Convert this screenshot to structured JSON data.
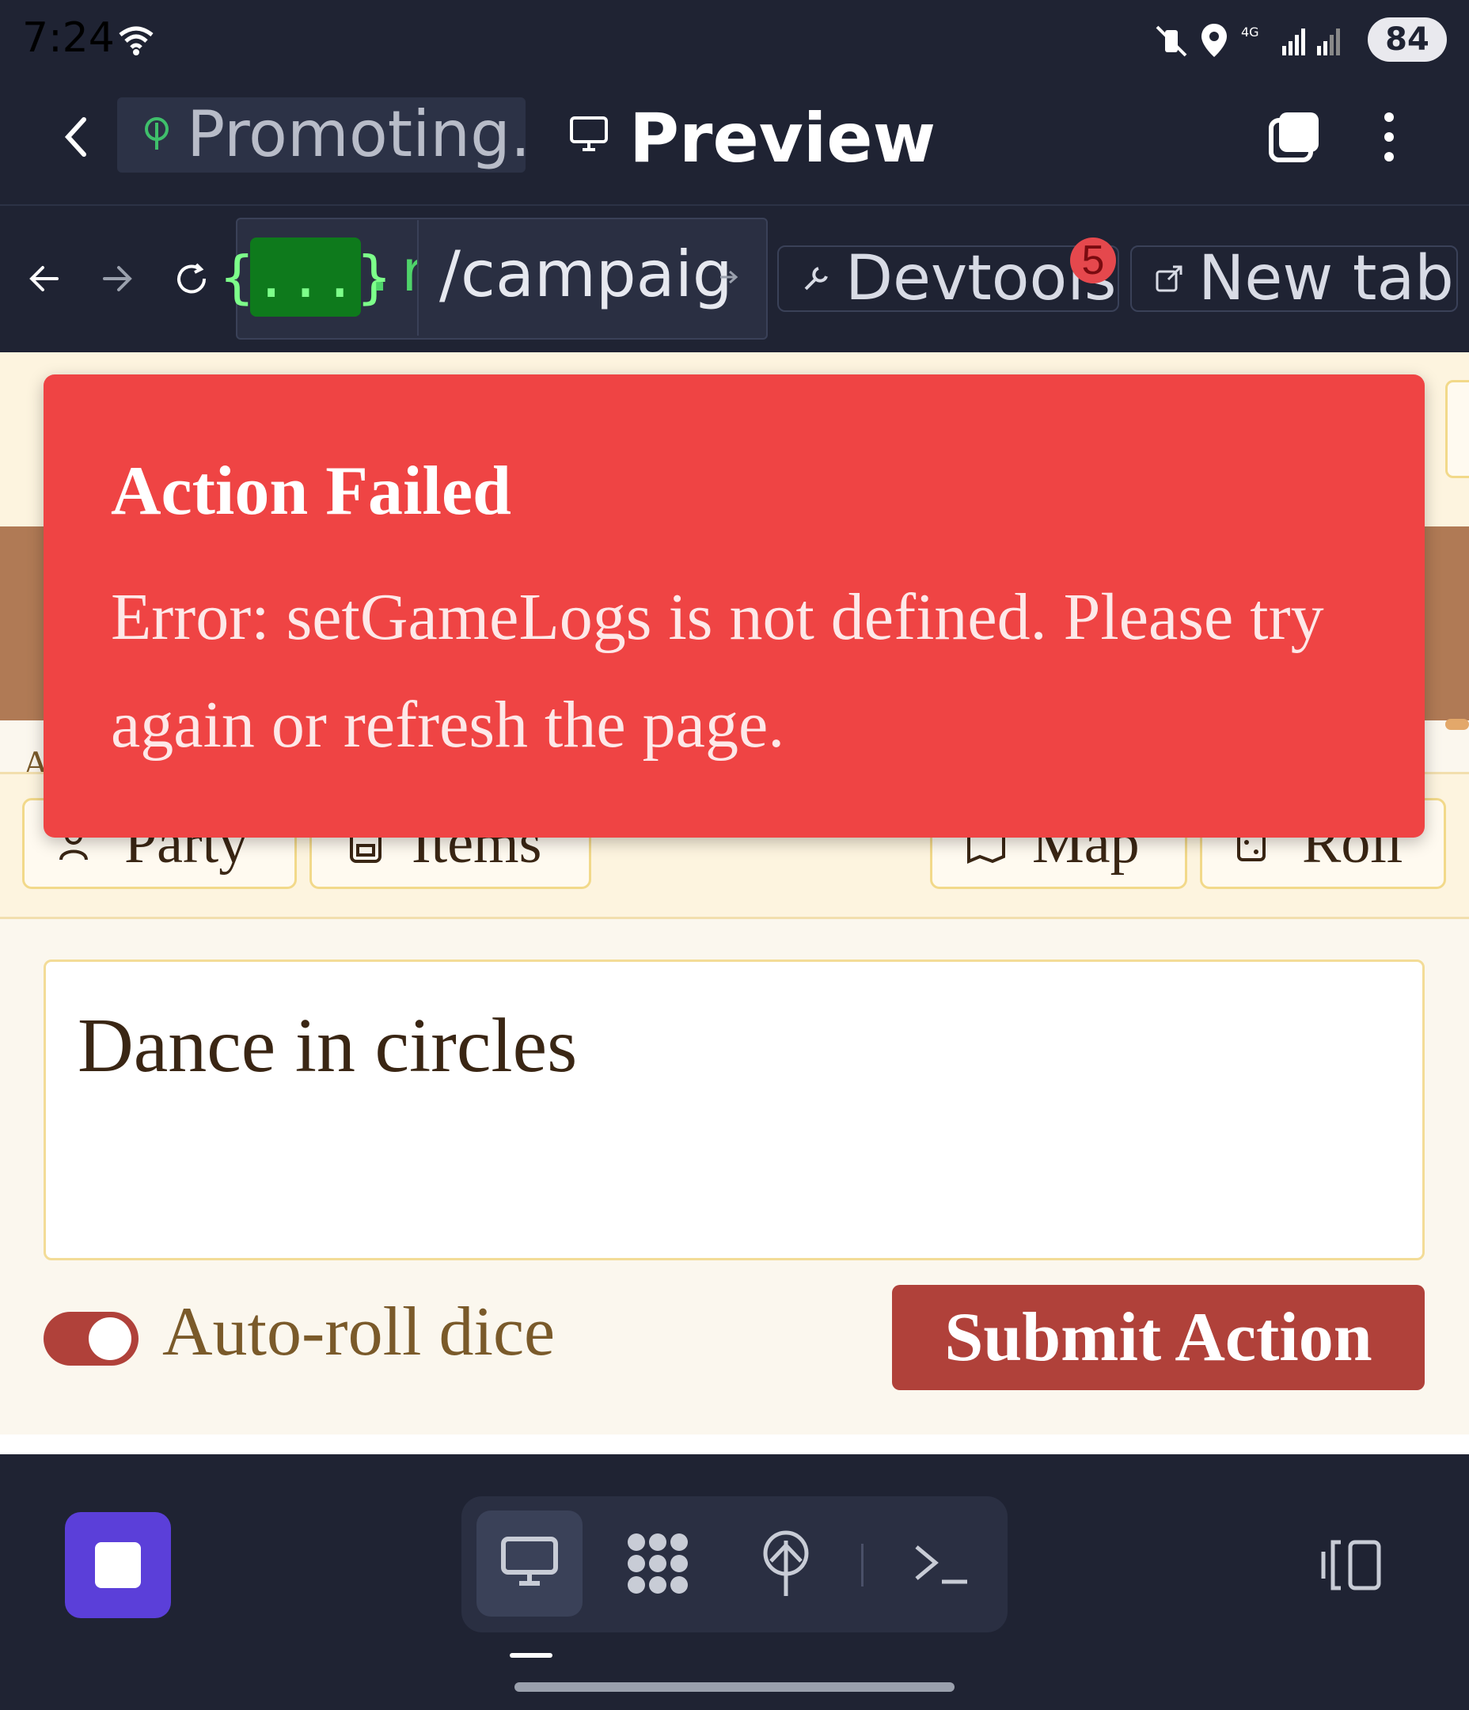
{
  "status_bar": {
    "time": "7:24",
    "battery": "84"
  },
  "header": {
    "tab_label": "Promoting...",
    "title": "Preview"
  },
  "browser": {
    "url_chip": "{...}",
    "url_domain": ".re",
    "url_path": "/campaig",
    "devtools_label": "Devtools",
    "devtools_badge": "5",
    "new_tab_label": "New tab"
  },
  "page": {
    "partial_letter": "A",
    "tabs": [
      {
        "label": "Party"
      },
      {
        "label": "Items"
      },
      {
        "label": "Map"
      },
      {
        "label": "Roll"
      }
    ],
    "action_input": {
      "value": "Dance in circles"
    },
    "auto_roll": {
      "label": "Auto-roll dice",
      "enabled": true
    },
    "submit_label": "Submit Action"
  },
  "toast": {
    "title": "Action Failed",
    "message": "Error: setGameLogs is not defined. Please try again or refresh the page."
  },
  "colors": {
    "toast": "#ef4444",
    "accent": "#b0413a",
    "brand_stop": "#5b3fd9"
  }
}
